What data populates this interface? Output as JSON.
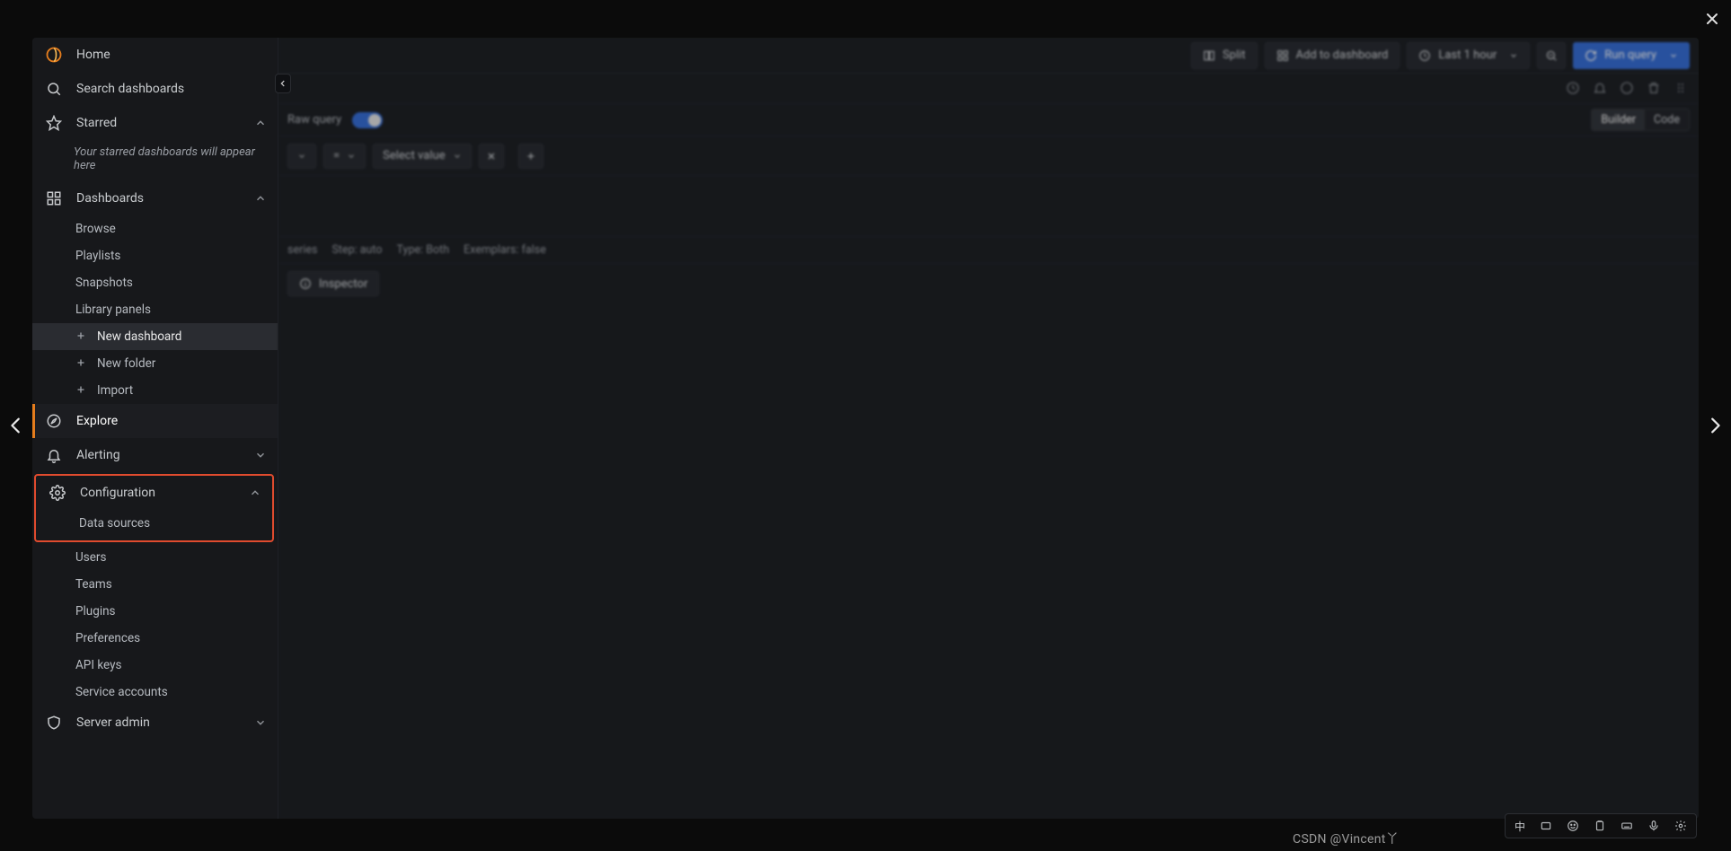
{
  "sidebar": {
    "home": "Home",
    "search": "Search dashboards",
    "starred": {
      "label": "Starred",
      "hint": "Your starred dashboards will appear here"
    },
    "dashboards": {
      "label": "Dashboards",
      "items": {
        "browse": "Browse",
        "playlists": "Playlists",
        "snapshots": "Snapshots",
        "library_panels": "Library panels",
        "new_dashboard": "New dashboard",
        "new_folder": "New folder",
        "import": "Import"
      }
    },
    "explore": "Explore",
    "alerting": "Alerting",
    "configuration": {
      "label": "Configuration",
      "items": {
        "data_sources": "Data sources",
        "users": "Users",
        "teams": "Teams",
        "plugins": "Plugins",
        "preferences": "Preferences",
        "api_keys": "API keys",
        "service_accounts": "Service accounts"
      }
    },
    "server_admin": "Server admin"
  },
  "topbar": {
    "split": "Split",
    "add_to_dashboard": "Add to dashboard",
    "time_range": "Last 1 hour",
    "run_query": "Run query"
  },
  "query": {
    "raw_query_label": "Raw query",
    "mode_builder": "Builder",
    "mode_code": "Code",
    "eq": "=",
    "select_value": "Select value",
    "options": {
      "series": "series",
      "step": {
        "label": "Step:",
        "value": "auto"
      },
      "type": {
        "label": "Type:",
        "value": "Both"
      },
      "exemplars": {
        "label": "Exemplars:",
        "value": "false"
      }
    },
    "inspector": "Inspector"
  },
  "ime": {
    "lang": "中"
  },
  "watermark": "CSDN @Vincent丫"
}
